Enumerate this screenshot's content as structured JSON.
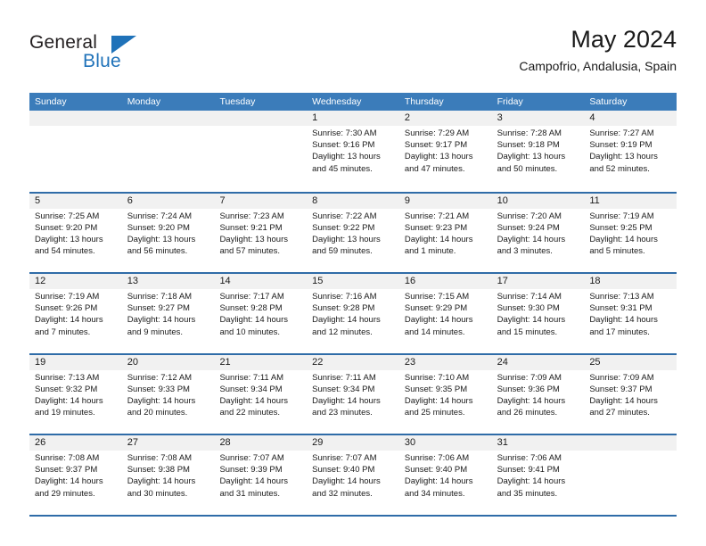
{
  "brand": {
    "name_part1": "General",
    "name_part2": "Blue",
    "triangle_icon": "blue-triangle-logo-mark",
    "accent_color": "#1f72b9"
  },
  "header": {
    "title": "May 2024",
    "subtitle": "Campofrio, Andalusia, Spain"
  },
  "theme": {
    "header_row_bg": "#3b7cba",
    "row_separator": "#2f6ca8",
    "date_band_bg": "#f1f1f1",
    "text": "#1a1a1a"
  },
  "calendar": {
    "day_names": [
      "Sunday",
      "Monday",
      "Tuesday",
      "Wednesday",
      "Thursday",
      "Friday",
      "Saturday"
    ],
    "labels": {
      "sunrise": "Sunrise:",
      "sunset": "Sunset:",
      "daylight": "Daylight:"
    },
    "weeks": [
      [
        {
          "day": "",
          "empty": true
        },
        {
          "day": "",
          "empty": true
        },
        {
          "day": "",
          "empty": true
        },
        {
          "day": "1",
          "sunrise": "Sunrise: 7:30 AM",
          "sunset": "Sunset: 9:16 PM",
          "daylight_line1": "Daylight: 13 hours",
          "daylight_line2": "and 45 minutes."
        },
        {
          "day": "2",
          "sunrise": "Sunrise: 7:29 AM",
          "sunset": "Sunset: 9:17 PM",
          "daylight_line1": "Daylight: 13 hours",
          "daylight_line2": "and 47 minutes."
        },
        {
          "day": "3",
          "sunrise": "Sunrise: 7:28 AM",
          "sunset": "Sunset: 9:18 PM",
          "daylight_line1": "Daylight: 13 hours",
          "daylight_line2": "and 50 minutes."
        },
        {
          "day": "4",
          "sunrise": "Sunrise: 7:27 AM",
          "sunset": "Sunset: 9:19 PM",
          "daylight_line1": "Daylight: 13 hours",
          "daylight_line2": "and 52 minutes."
        }
      ],
      [
        {
          "day": "5",
          "sunrise": "Sunrise: 7:25 AM",
          "sunset": "Sunset: 9:20 PM",
          "daylight_line1": "Daylight: 13 hours",
          "daylight_line2": "and 54 minutes."
        },
        {
          "day": "6",
          "sunrise": "Sunrise: 7:24 AM",
          "sunset": "Sunset: 9:20 PM",
          "daylight_line1": "Daylight: 13 hours",
          "daylight_line2": "and 56 minutes."
        },
        {
          "day": "7",
          "sunrise": "Sunrise: 7:23 AM",
          "sunset": "Sunset: 9:21 PM",
          "daylight_line1": "Daylight: 13 hours",
          "daylight_line2": "and 57 minutes."
        },
        {
          "day": "8",
          "sunrise": "Sunrise: 7:22 AM",
          "sunset": "Sunset: 9:22 PM",
          "daylight_line1": "Daylight: 13 hours",
          "daylight_line2": "and 59 minutes."
        },
        {
          "day": "9",
          "sunrise": "Sunrise: 7:21 AM",
          "sunset": "Sunset: 9:23 PM",
          "daylight_line1": "Daylight: 14 hours",
          "daylight_line2": "and 1 minute."
        },
        {
          "day": "10",
          "sunrise": "Sunrise: 7:20 AM",
          "sunset": "Sunset: 9:24 PM",
          "daylight_line1": "Daylight: 14 hours",
          "daylight_line2": "and 3 minutes."
        },
        {
          "day": "11",
          "sunrise": "Sunrise: 7:19 AM",
          "sunset": "Sunset: 9:25 PM",
          "daylight_line1": "Daylight: 14 hours",
          "daylight_line2": "and 5 minutes."
        }
      ],
      [
        {
          "day": "12",
          "sunrise": "Sunrise: 7:19 AM",
          "sunset": "Sunset: 9:26 PM",
          "daylight_line1": "Daylight: 14 hours",
          "daylight_line2": "and 7 minutes."
        },
        {
          "day": "13",
          "sunrise": "Sunrise: 7:18 AM",
          "sunset": "Sunset: 9:27 PM",
          "daylight_line1": "Daylight: 14 hours",
          "daylight_line2": "and 9 minutes."
        },
        {
          "day": "14",
          "sunrise": "Sunrise: 7:17 AM",
          "sunset": "Sunset: 9:28 PM",
          "daylight_line1": "Daylight: 14 hours",
          "daylight_line2": "and 10 minutes."
        },
        {
          "day": "15",
          "sunrise": "Sunrise: 7:16 AM",
          "sunset": "Sunset: 9:28 PM",
          "daylight_line1": "Daylight: 14 hours",
          "daylight_line2": "and 12 minutes."
        },
        {
          "day": "16",
          "sunrise": "Sunrise: 7:15 AM",
          "sunset": "Sunset: 9:29 PM",
          "daylight_line1": "Daylight: 14 hours",
          "daylight_line2": "and 14 minutes."
        },
        {
          "day": "17",
          "sunrise": "Sunrise: 7:14 AM",
          "sunset": "Sunset: 9:30 PM",
          "daylight_line1": "Daylight: 14 hours",
          "daylight_line2": "and 15 minutes."
        },
        {
          "day": "18",
          "sunrise": "Sunrise: 7:13 AM",
          "sunset": "Sunset: 9:31 PM",
          "daylight_line1": "Daylight: 14 hours",
          "daylight_line2": "and 17 minutes."
        }
      ],
      [
        {
          "day": "19",
          "sunrise": "Sunrise: 7:13 AM",
          "sunset": "Sunset: 9:32 PM",
          "daylight_line1": "Daylight: 14 hours",
          "daylight_line2": "and 19 minutes."
        },
        {
          "day": "20",
          "sunrise": "Sunrise: 7:12 AM",
          "sunset": "Sunset: 9:33 PM",
          "daylight_line1": "Daylight: 14 hours",
          "daylight_line2": "and 20 minutes."
        },
        {
          "day": "21",
          "sunrise": "Sunrise: 7:11 AM",
          "sunset": "Sunset: 9:34 PM",
          "daylight_line1": "Daylight: 14 hours",
          "daylight_line2": "and 22 minutes."
        },
        {
          "day": "22",
          "sunrise": "Sunrise: 7:11 AM",
          "sunset": "Sunset: 9:34 PM",
          "daylight_line1": "Daylight: 14 hours",
          "daylight_line2": "and 23 minutes."
        },
        {
          "day": "23",
          "sunrise": "Sunrise: 7:10 AM",
          "sunset": "Sunset: 9:35 PM",
          "daylight_line1": "Daylight: 14 hours",
          "daylight_line2": "and 25 minutes."
        },
        {
          "day": "24",
          "sunrise": "Sunrise: 7:09 AM",
          "sunset": "Sunset: 9:36 PM",
          "daylight_line1": "Daylight: 14 hours",
          "daylight_line2": "and 26 minutes."
        },
        {
          "day": "25",
          "sunrise": "Sunrise: 7:09 AM",
          "sunset": "Sunset: 9:37 PM",
          "daylight_line1": "Daylight: 14 hours",
          "daylight_line2": "and 27 minutes."
        }
      ],
      [
        {
          "day": "26",
          "sunrise": "Sunrise: 7:08 AM",
          "sunset": "Sunset: 9:37 PM",
          "daylight_line1": "Daylight: 14 hours",
          "daylight_line2": "and 29 minutes."
        },
        {
          "day": "27",
          "sunrise": "Sunrise: 7:08 AM",
          "sunset": "Sunset: 9:38 PM",
          "daylight_line1": "Daylight: 14 hours",
          "daylight_line2": "and 30 minutes."
        },
        {
          "day": "28",
          "sunrise": "Sunrise: 7:07 AM",
          "sunset": "Sunset: 9:39 PM",
          "daylight_line1": "Daylight: 14 hours",
          "daylight_line2": "and 31 minutes."
        },
        {
          "day": "29",
          "sunrise": "Sunrise: 7:07 AM",
          "sunset": "Sunset: 9:40 PM",
          "daylight_line1": "Daylight: 14 hours",
          "daylight_line2": "and 32 minutes."
        },
        {
          "day": "30",
          "sunrise": "Sunrise: 7:06 AM",
          "sunset": "Sunset: 9:40 PM",
          "daylight_line1": "Daylight: 14 hours",
          "daylight_line2": "and 34 minutes."
        },
        {
          "day": "31",
          "sunrise": "Sunrise: 7:06 AM",
          "sunset": "Sunset: 9:41 PM",
          "daylight_line1": "Daylight: 14 hours",
          "daylight_line2": "and 35 minutes."
        },
        {
          "day": "",
          "empty": true
        }
      ]
    ]
  }
}
